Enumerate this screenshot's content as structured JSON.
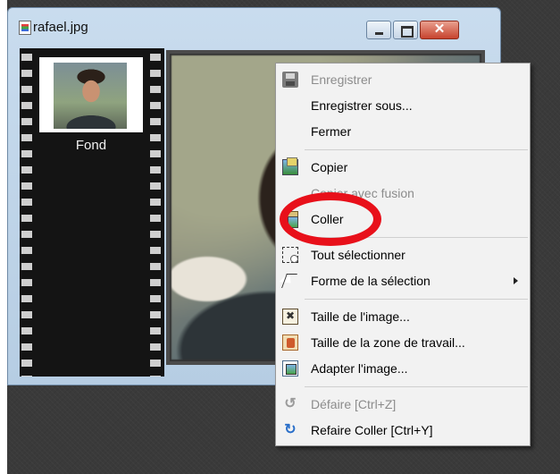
{
  "window": {
    "title": "rafael.jpg",
    "close_glyph": "✕"
  },
  "filmstrip": {
    "layer_label": "Fond"
  },
  "context_menu": {
    "items": [
      {
        "label": "Enregistrer",
        "enabled": false,
        "icon": "floppy-icon"
      },
      {
        "label": "Enregistrer sous...",
        "enabled": true
      },
      {
        "label": "Fermer",
        "enabled": true
      },
      {
        "label": "Copier",
        "enabled": true,
        "icon": "copy-icon"
      },
      {
        "label": "Copier avec fusion",
        "enabled": false
      },
      {
        "label": "Coller",
        "enabled": true,
        "icon": "paste-icon"
      },
      {
        "label": "Tout sélectionner",
        "enabled": true,
        "icon": "select-all-icon"
      },
      {
        "label": "Forme de la sélection",
        "enabled": true,
        "icon": "cursor-icon",
        "submenu": true
      },
      {
        "label": "Taille de l'image...",
        "enabled": true,
        "icon": "resize-image-icon"
      },
      {
        "label": "Taille de la zone de travail...",
        "enabled": true,
        "icon": "canvas-size-icon"
      },
      {
        "label": "Adapter l'image...",
        "enabled": true,
        "icon": "fit-image-icon"
      },
      {
        "label": "Défaire [Ctrl+Z]",
        "enabled": false,
        "icon": "undo-icon"
      },
      {
        "label": "Refaire Coller [Ctrl+Y]",
        "enabled": true,
        "icon": "redo-icon"
      }
    ]
  },
  "annotation": {
    "color": "#e8101a",
    "highlighted_item": "Coller"
  },
  "colors": {
    "workspace": "#3a3a3a",
    "window_frame": "#c9dcee",
    "menu_bg": "#f2f2f2",
    "disabled_text": "#8c8c8c"
  }
}
